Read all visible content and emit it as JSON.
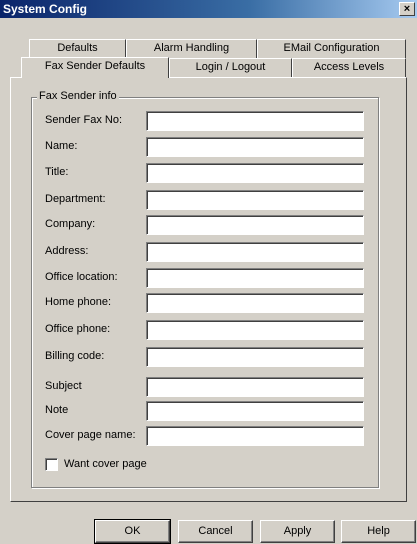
{
  "window": {
    "title": "System Config",
    "close_glyph": "×"
  },
  "tabs": {
    "row1": [
      "Defaults",
      "Alarm Handling",
      "EMail Configuration"
    ],
    "row2": [
      "Fax Sender Defaults",
      "Login / Logout",
      "Access Levels"
    ],
    "active": "Fax Sender Defaults"
  },
  "group": {
    "title": "Fax Sender info"
  },
  "fields": [
    {
      "label": "Sender Fax No:",
      "value": ""
    },
    {
      "label": "Name:",
      "value": ""
    },
    {
      "label": "Title:",
      "value": ""
    },
    {
      "label": "Department:",
      "value": ""
    },
    {
      "label": "Company:",
      "value": ""
    },
    {
      "label": "Address:",
      "value": ""
    },
    {
      "label": "Office location:",
      "value": ""
    },
    {
      "label": "Home phone:",
      "value": ""
    },
    {
      "label": "Office phone:",
      "value": ""
    },
    {
      "label": "Billing code:",
      "value": ""
    },
    {
      "label": "Subject",
      "value": ""
    },
    {
      "label": "Note",
      "value": ""
    },
    {
      "label": "Cover page name:",
      "value": ""
    }
  ],
  "checkbox": {
    "label": "Want cover page",
    "checked": false
  },
  "buttons": {
    "ok": "OK",
    "cancel": "Cancel",
    "apply": "Apply",
    "help": "Help"
  }
}
